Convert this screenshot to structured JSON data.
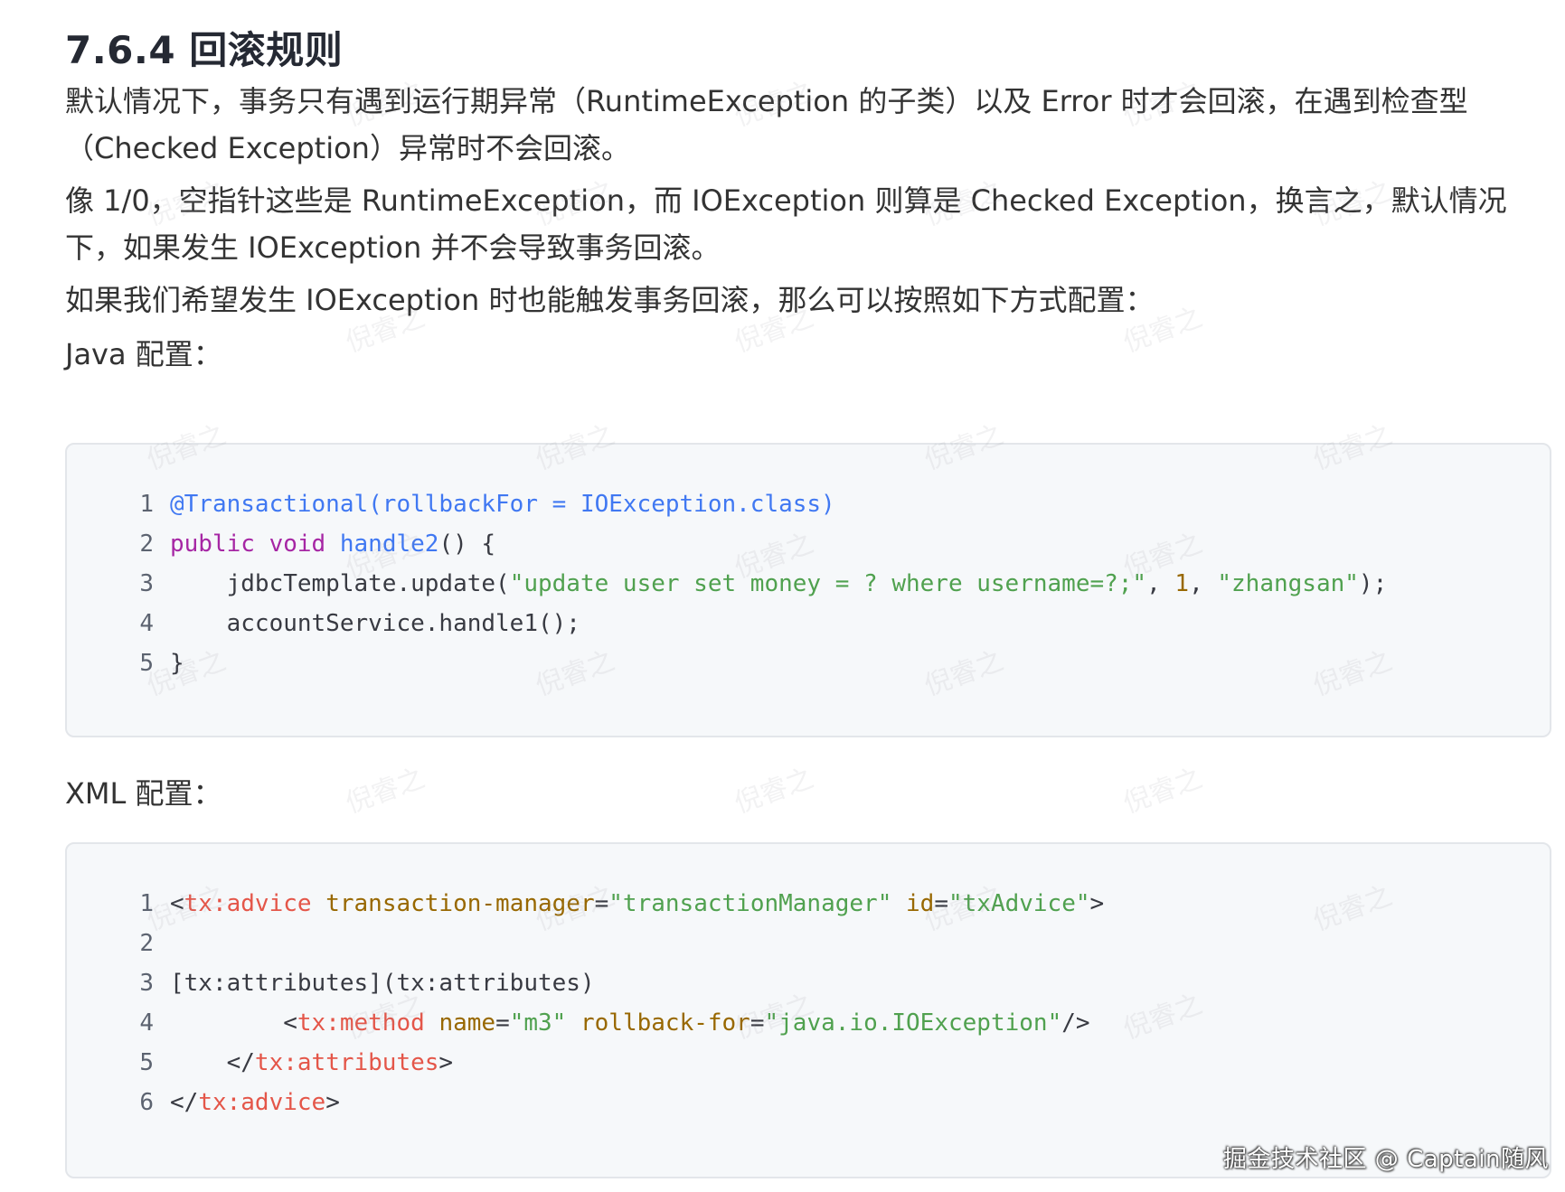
{
  "section": {
    "title": "7.6.4 回滚规则"
  },
  "paragraphs": {
    "p1": "默认情况下，事务只有遇到运行期异常（RuntimeException 的子类）以及 Error 时才会回滚，在遇到检查型（Checked Exception）异常时不会回滚。",
    "p2": "像 1/0，空指针这些是 RuntimeException，而 IOException 则算是 Checked Exception，换言之，默认情况下，如果发生 IOException 并不会导致事务回滚。",
    "p3": "如果我们希望发生 IOException 时也能触发事务回滚，那么可以按照如下方式配置：",
    "java_label": "Java 配置：",
    "xml_label": "XML 配置："
  },
  "java_code": {
    "lines": [
      {
        "n": "1",
        "tokens": [
          {
            "c": "t-anno",
            "t": "@Transactional(rollbackFor = IOException.class)"
          }
        ]
      },
      {
        "n": "2",
        "tokens": [
          {
            "c": "t-kw",
            "t": "public"
          },
          {
            "c": "t-plain",
            "t": " "
          },
          {
            "c": "t-kw",
            "t": "void"
          },
          {
            "c": "t-plain",
            "t": " "
          },
          {
            "c": "t-fn",
            "t": "handle2"
          },
          {
            "c": "t-plain",
            "t": "() {"
          }
        ]
      },
      {
        "n": "3",
        "tokens": [
          {
            "c": "t-plain",
            "t": "    jdbcTemplate.update("
          },
          {
            "c": "t-str",
            "t": "\"update user set money = ? where username=?;\""
          },
          {
            "c": "t-plain",
            "t": ", "
          },
          {
            "c": "t-num",
            "t": "1"
          },
          {
            "c": "t-plain",
            "t": ", "
          },
          {
            "c": "t-str",
            "t": "\"zhangsan\""
          },
          {
            "c": "t-plain",
            "t": ");"
          }
        ]
      },
      {
        "n": "4",
        "tokens": [
          {
            "c": "t-plain",
            "t": "    accountService.handle1();"
          }
        ]
      },
      {
        "n": "5",
        "tokens": [
          {
            "c": "t-plain",
            "t": "}"
          }
        ]
      }
    ]
  },
  "xml_code": {
    "lines": [
      {
        "n": "1",
        "tokens": [
          {
            "c": "t-plain",
            "t": "<"
          },
          {
            "c": "t-tag",
            "t": "tx:advice"
          },
          {
            "c": "t-plain",
            "t": " "
          },
          {
            "c": "t-attr",
            "t": "transaction-manager"
          },
          {
            "c": "t-plain",
            "t": "="
          },
          {
            "c": "t-str",
            "t": "\"transactionManager\""
          },
          {
            "c": "t-plain",
            "t": " "
          },
          {
            "c": "t-attr",
            "t": "id"
          },
          {
            "c": "t-plain",
            "t": "="
          },
          {
            "c": "t-str",
            "t": "\"txAdvice\""
          },
          {
            "c": "t-plain",
            "t": ">"
          }
        ]
      },
      {
        "n": "2",
        "tokens": []
      },
      {
        "n": "3",
        "tokens": [
          {
            "c": "t-plain",
            "t": "[tx:attributes](tx:attributes)"
          }
        ]
      },
      {
        "n": "4",
        "tokens": [
          {
            "c": "t-plain",
            "t": "        <"
          },
          {
            "c": "t-tag",
            "t": "tx:method"
          },
          {
            "c": "t-plain",
            "t": " "
          },
          {
            "c": "t-attr",
            "t": "name"
          },
          {
            "c": "t-plain",
            "t": "="
          },
          {
            "c": "t-str",
            "t": "\"m3\""
          },
          {
            "c": "t-plain",
            "t": " "
          },
          {
            "c": "t-attr",
            "t": "rollback-for"
          },
          {
            "c": "t-plain",
            "t": "="
          },
          {
            "c": "t-str",
            "t": "\"java.io.IOException\""
          },
          {
            "c": "t-plain",
            "t": "/>"
          }
        ]
      },
      {
        "n": "5",
        "tokens": [
          {
            "c": "t-plain",
            "t": "    </"
          },
          {
            "c": "t-tag",
            "t": "tx:attributes"
          },
          {
            "c": "t-plain",
            "t": ">"
          }
        ]
      },
      {
        "n": "6",
        "tokens": [
          {
            "c": "t-plain",
            "t": "</"
          },
          {
            "c": "t-tag",
            "t": "tx:advice"
          },
          {
            "c": "t-plain",
            "t": ">"
          }
        ]
      }
    ]
  },
  "watermark": {
    "text": "倪睿之"
  },
  "footer": {
    "credit": "掘金技术社区 @ Captain随风"
  }
}
